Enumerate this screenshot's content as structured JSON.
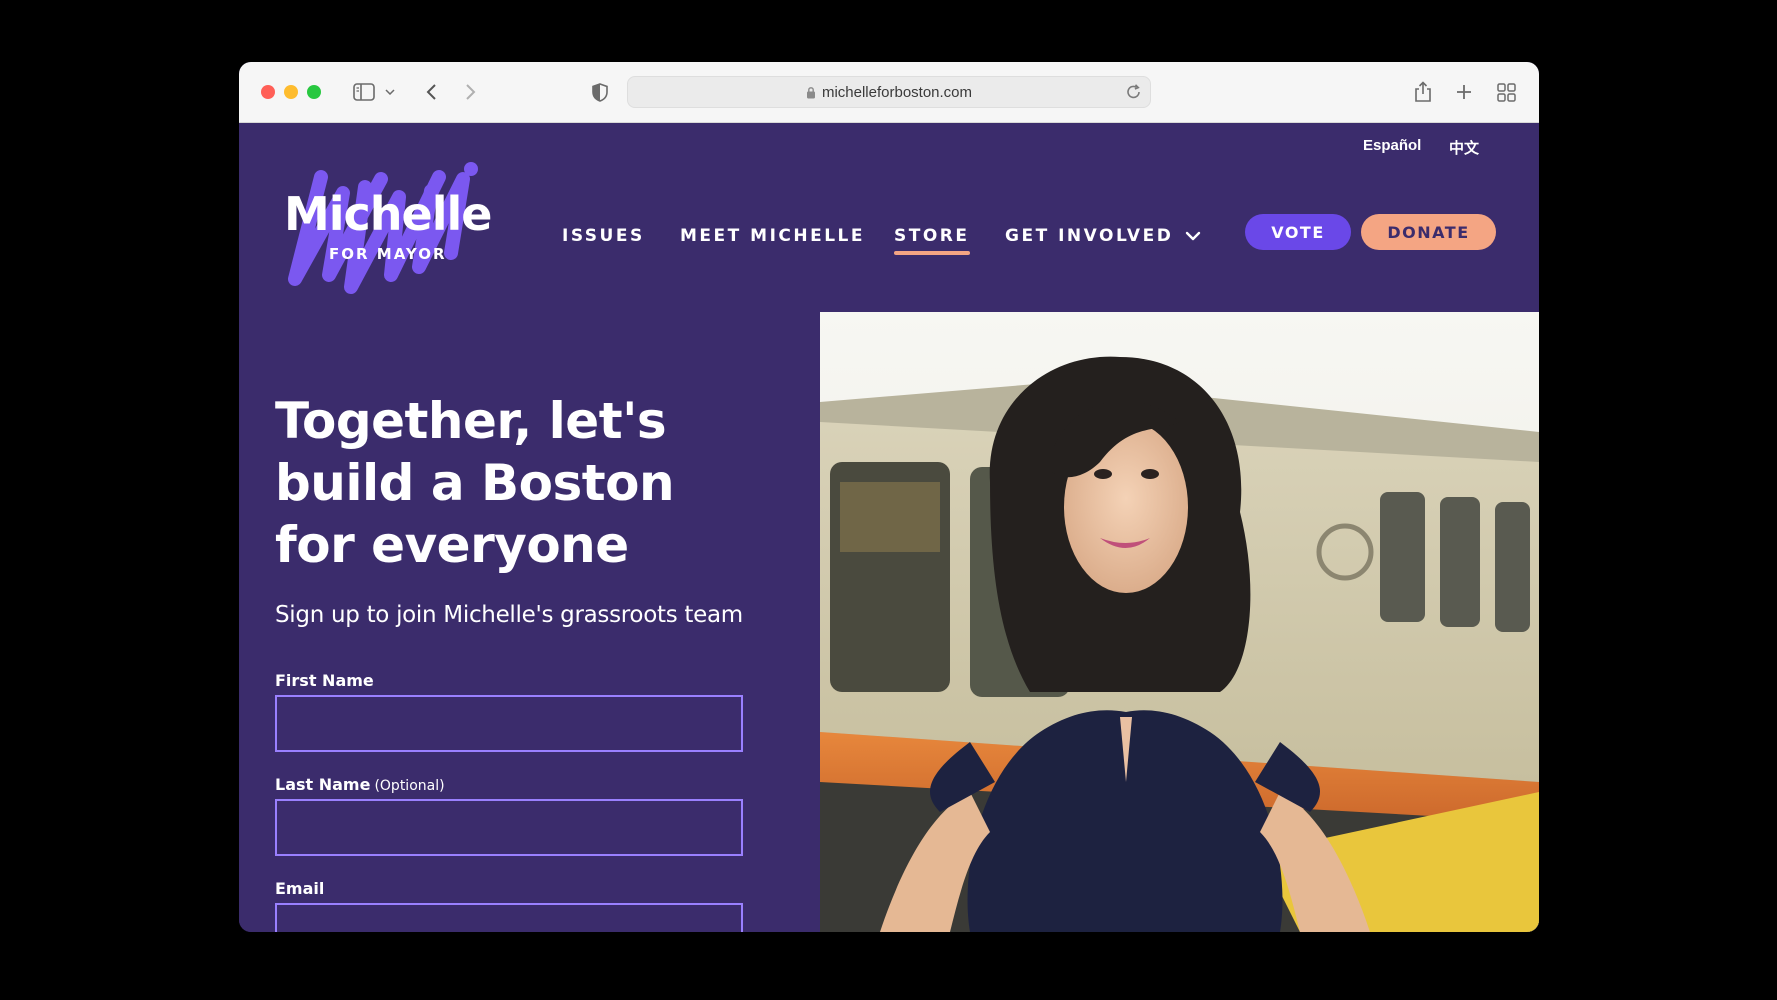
{
  "browser": {
    "url": "michelleforboston.com"
  },
  "site": {
    "languages": [
      "Español",
      "中文"
    ],
    "logo": {
      "name": "Michelle",
      "subtitle": "FOR MAYOR"
    },
    "nav": {
      "issues": "ISSUES",
      "meet": "MEET MICHELLE",
      "store": "STORE",
      "get_involved": "GET INVOLVED"
    },
    "vote_label": "VOTE",
    "donate_label": "DONATE",
    "hero": {
      "headline": "Together, let's build a Boston for everyone",
      "subhead": "Sign up to join Michelle's grassroots team"
    },
    "form": {
      "first_name_label": "First Name",
      "first_name_value": "",
      "last_name_label": "Last Name",
      "last_name_optional": "(Optional)",
      "last_name_value": "",
      "email_label": "Email",
      "email_value": ""
    }
  },
  "colors": {
    "brand_purple": "#3b2c6c",
    "vote_button": "#6a48e8",
    "donate_button": "#f4a583",
    "input_border": "#9a80ff"
  }
}
